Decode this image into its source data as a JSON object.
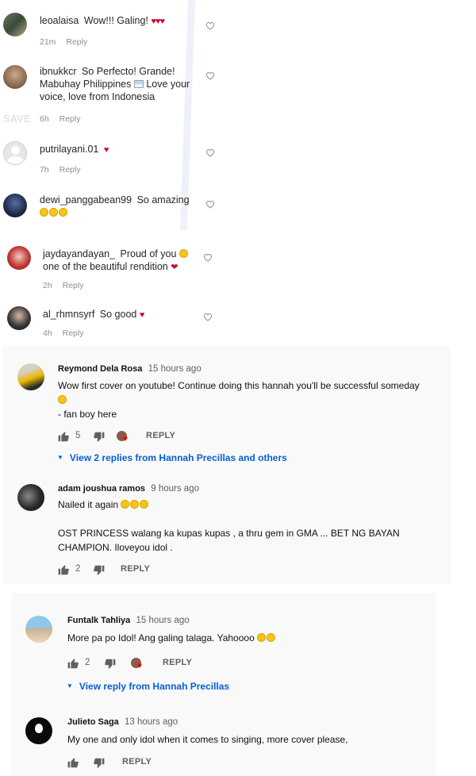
{
  "instagram": {
    "comments": [
      {
        "username": "leoalaisa",
        "text": "Wow!!! Galing!",
        "hearts": "♥♥♥",
        "time": "21m",
        "reply": "Reply"
      },
      {
        "username": "ibnukkcr",
        "text_line1": "So Perfecto! Grande!",
        "text_line2": "Mabuhay Philippines",
        "text_line2b": "Love your",
        "text_line3": "voice, love from Indonesia",
        "time": "6h",
        "reply": "Reply"
      },
      {
        "username": "putrilayani.01",
        "hearts": "♥",
        "time": "7h",
        "reply": "Reply"
      },
      {
        "username": "dewi_panggabean99",
        "text": "So amazing",
        "time": "",
        "reply": ""
      },
      {
        "username": "jaydayandayan_",
        "text_line1": "Proud of you",
        "text_line2": "one of the beautiful rendition",
        "time": "2h",
        "reply": "Reply"
      },
      {
        "username": "al_rhmnsyrf",
        "text": "So good",
        "hearts": "♥",
        "time": "4h",
        "reply": "Reply"
      }
    ],
    "ghost_label": "SAVE"
  },
  "youtube": {
    "comments": [
      {
        "author": "Reymond Dela Rosa",
        "time": "15 hours ago",
        "line1": "Wow first cover on youtube!  Continue doing this hannah you'll be successful someday",
        "line3": "- fan boy here",
        "likes": "5",
        "reply": "REPLY",
        "view_replies": "View 2 replies from Hannah Precillas and others"
      },
      {
        "author": "adam joushua ramos",
        "time": "9 hours ago",
        "line1": "Nailed it again",
        "line2": "OST PRINCESS walang ka kupas kupas , a thru gem in GMA ... BET NG BAYAN",
        "line3": "CHAMPION. Iloveyou idol .",
        "likes": "2",
        "reply": "REPLY"
      },
      {
        "author": "Funtalk Tahliya",
        "time": "15 hours ago",
        "line1": "More pa po Idol! Ang galing talaga. Yahoooo",
        "likes": "2",
        "reply": "REPLY",
        "view_replies": "View reply from Hannah Precillas"
      },
      {
        "author": "Julieto Saga",
        "time": "13 hours ago",
        "line1": "My one and only idol when it comes to singing, more cover please,",
        "likes": "",
        "reply": "REPLY"
      }
    ]
  },
  "colors": {
    "heart_red": "#c8102e",
    "link_blue": "#065fd4",
    "meta_gray": "#8e8e8e",
    "yt_bg": "#f9f9f9"
  }
}
